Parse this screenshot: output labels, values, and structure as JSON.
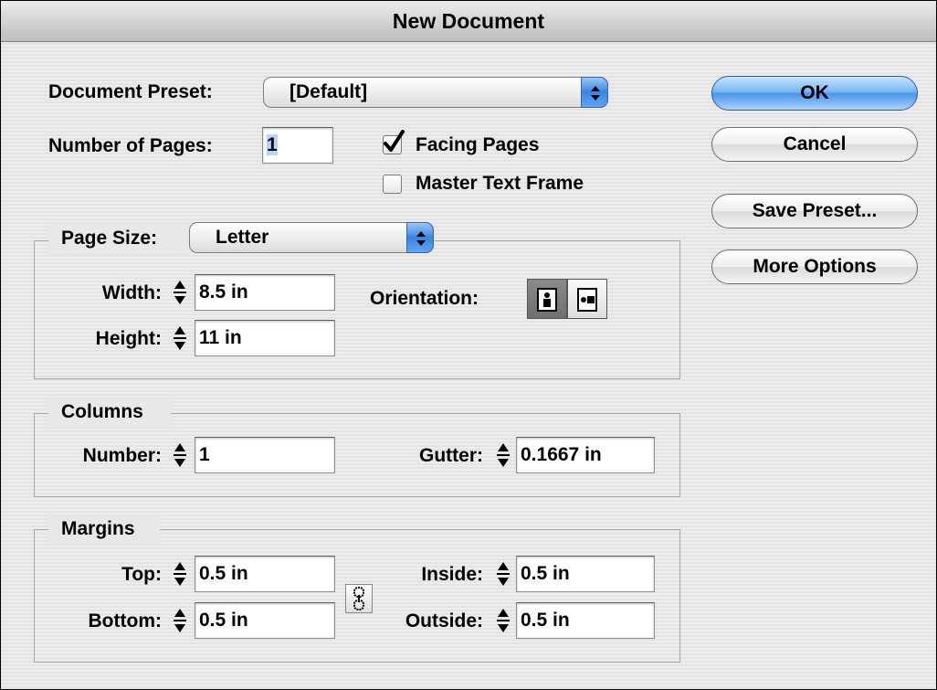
{
  "window": {
    "title": "New Document"
  },
  "preset": {
    "label": "Document Preset:",
    "value": "[Default]"
  },
  "pages": {
    "label": "Number of Pages:",
    "value": "1"
  },
  "facing_pages": {
    "label": "Facing Pages",
    "checked": true
  },
  "master_text_frame": {
    "label": "Master Text Frame",
    "checked": false
  },
  "page_size": {
    "title": "Page Size:",
    "value": "Letter",
    "width_label": "Width:",
    "width_value": "8.5 in",
    "height_label": "Height:",
    "height_value": "11 in",
    "orientation_label": "Orientation:",
    "orientation_selected": "portrait"
  },
  "columns": {
    "title": "Columns",
    "number_label": "Number:",
    "number_value": "1",
    "gutter_label": "Gutter:",
    "gutter_value": "0.1667 in"
  },
  "margins": {
    "title": "Margins",
    "top_label": "Top:",
    "top_value": "0.5 in",
    "bottom_label": "Bottom:",
    "bottom_value": "0.5 in",
    "inside_label": "Inside:",
    "inside_value": "0.5 in",
    "outside_label": "Outside:",
    "outside_value": "0.5 in"
  },
  "buttons": {
    "ok": "OK",
    "cancel": "Cancel",
    "save_preset": "Save Preset...",
    "more_options": "More Options"
  },
  "colors": {
    "accent": "#4d95ea"
  }
}
